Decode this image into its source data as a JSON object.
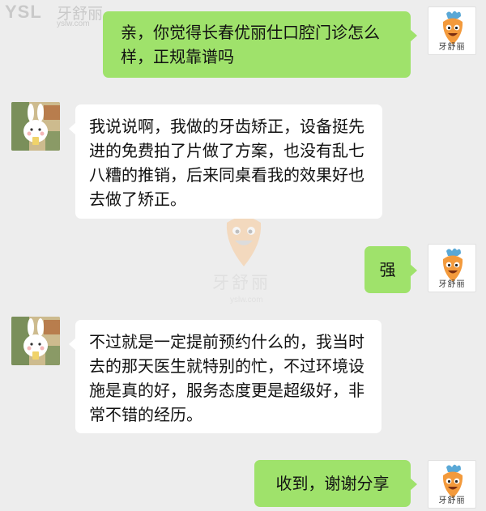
{
  "watermark": {
    "brand_latin": "YSL",
    "brand_cn": "牙舒丽",
    "site": "yslw.com"
  },
  "avatars": {
    "self_label": "牙舒丽"
  },
  "messages": [
    {
      "side": "sent",
      "text": "亲，你觉得长春优丽仕口腔门诊怎么样，正规靠谱吗"
    },
    {
      "side": "recv",
      "text": "我说说啊，我做的牙齿矫正，设备挺先进的免费拍了片做了方案，也没有乱七八糟的推销，后来同桌看我的效果好也去做了矫正。"
    },
    {
      "side": "sent",
      "text": "强"
    },
    {
      "side": "recv",
      "text": "不过就是一定提前预约什么的，我当时去的那天医生就特别的忙，不过环境设施是真的好，服务态度更是超级好，非常不错的经历。"
    },
    {
      "side": "sent",
      "text": "收到，谢谢分享"
    }
  ],
  "colors": {
    "background": "#ededed",
    "sent_bubble": "#9fe26b",
    "recv_bubble": "#ffffff",
    "carrot": "#f39a3c",
    "carrot_leaves": "#5aa8d6"
  },
  "icons": {
    "self_avatar": "carrot-mascot-icon",
    "other_avatar": "cartoon-bunny-icon"
  }
}
